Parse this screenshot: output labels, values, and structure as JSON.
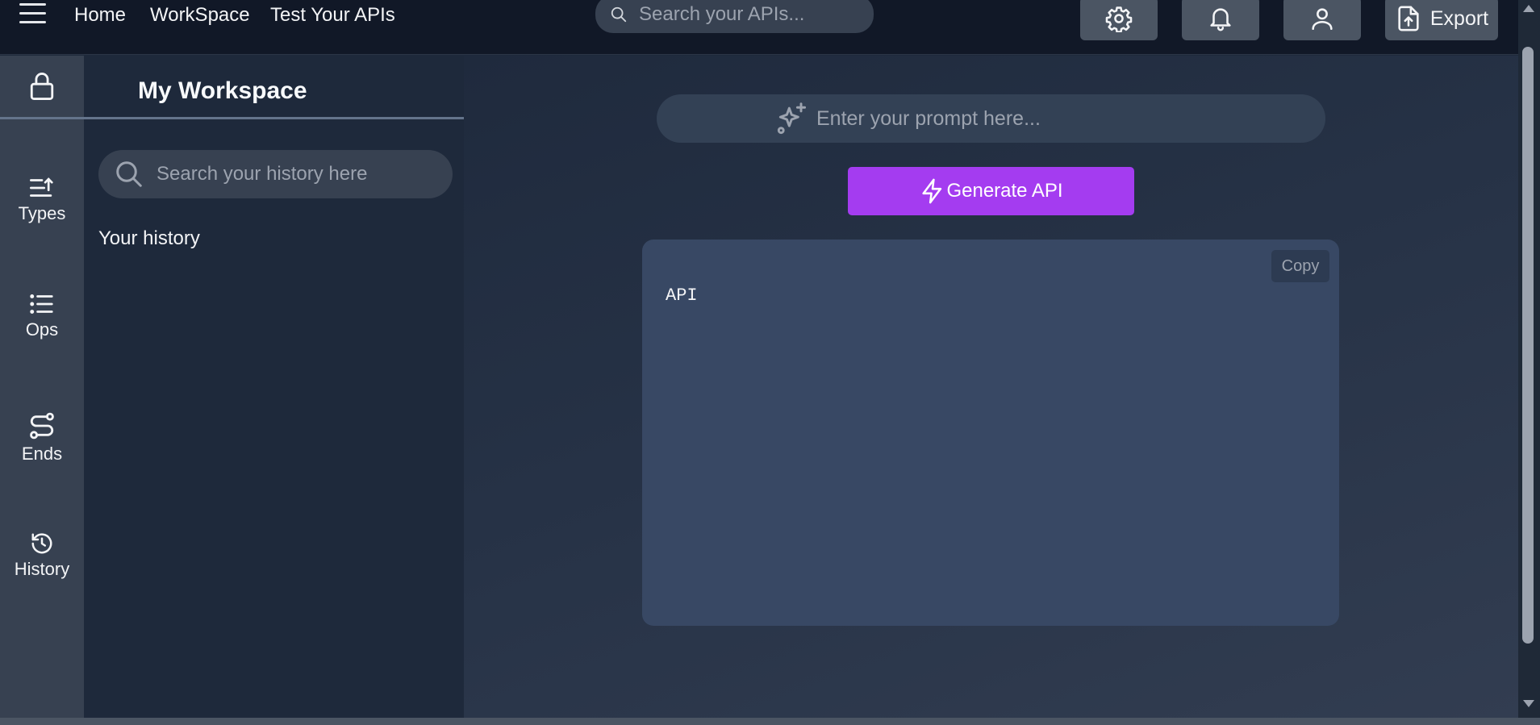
{
  "nav": {
    "links": [
      "Home",
      "WorkSpace",
      "Test Your APIs"
    ],
    "search_placeholder": "Search your APIs...",
    "export_label": "Export",
    "icons": [
      "menu-icon",
      "gear-icon",
      "bell-icon",
      "user-icon",
      "file-upload-icon"
    ]
  },
  "rail": {
    "items": [
      {
        "icon": "sort-list-icon",
        "label": "Types"
      },
      {
        "icon": "list-icon",
        "label": "Ops"
      },
      {
        "icon": "route-icon",
        "label": "Ends"
      },
      {
        "icon": "history-icon",
        "label": "History"
      }
    ]
  },
  "sidebar": {
    "title": "My Workspace",
    "search_placeholder": "Search your history here",
    "history_label": "Your history"
  },
  "main": {
    "prompt_placeholder": "Enter your prompt here...",
    "generate_label": "Generate API",
    "copy_label": "Copy",
    "output_text": "API"
  },
  "colors": {
    "accent": "#a43cf0",
    "topbar": "#111827",
    "rail": "#374151",
    "sidebar": "#1e293b",
    "output_panel": "#384864"
  }
}
